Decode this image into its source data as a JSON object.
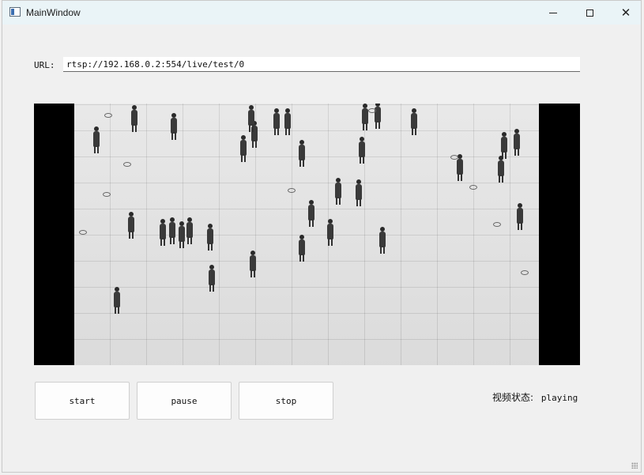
{
  "window": {
    "title": "MainWindow"
  },
  "url": {
    "label": "URL:",
    "value": "rtsp://192.168.0.2:554/live/test/0"
  },
  "controls": {
    "start_label": "start",
    "pause_label": "pause",
    "stop_label": "stop"
  },
  "status": {
    "label": "视频状态:",
    "value": "playing"
  },
  "video": {
    "content": "grayscale overhead view of pedestrians walking on a tiled plaza"
  },
  "icons": {
    "app": "app-window-icon",
    "minimize": "minimize-icon",
    "maximize": "maximize-icon",
    "close": "close-icon"
  },
  "colors": {
    "titlebar": "#eaf4f7",
    "window_bg": "#f0f0f0",
    "video_bg": "#000000"
  }
}
